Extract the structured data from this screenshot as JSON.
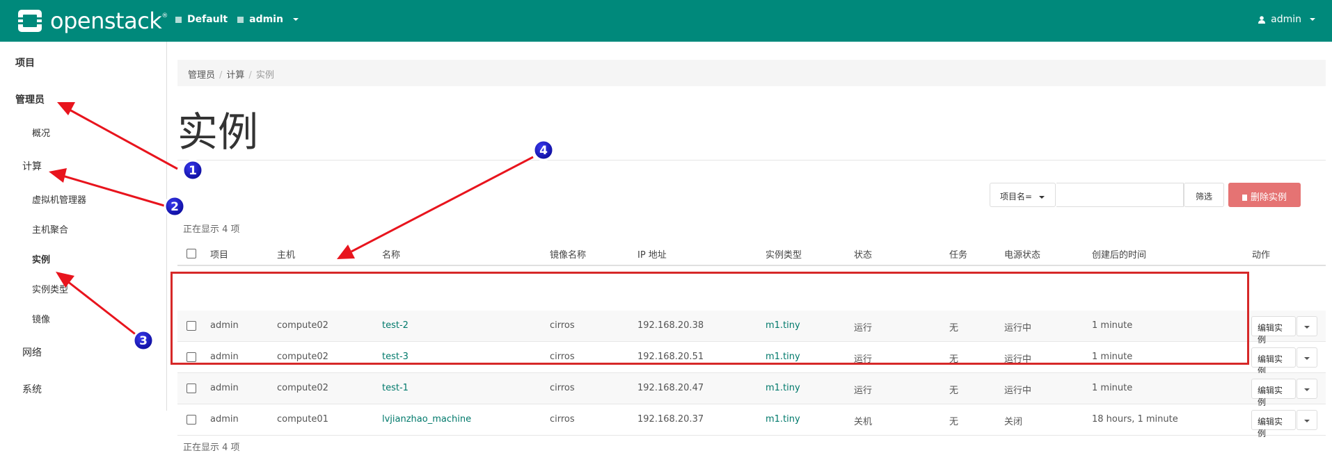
{
  "header": {
    "brand": "openstack",
    "domain": "Default",
    "project": "admin",
    "user": "admin"
  },
  "sidebar": {
    "items": [
      {
        "label": "项目"
      },
      {
        "label": "管理员"
      },
      {
        "label": "概况"
      },
      {
        "label": "计算"
      },
      {
        "label": "虚拟机管理器"
      },
      {
        "label": "主机聚合"
      },
      {
        "label": "实例"
      },
      {
        "label": "实例类型"
      },
      {
        "label": "镜像"
      },
      {
        "label": "网络"
      },
      {
        "label": "系统"
      }
    ]
  },
  "breadcrumb": [
    "管理员",
    "计算",
    "实例"
  ],
  "page_title": "实例",
  "filter": {
    "dropdown_label": "项目名=",
    "filter_button": "筛选",
    "delete_button": "删除实例"
  },
  "count_text": "正在显示 4 项",
  "table": {
    "columns": [
      "项目",
      "主机",
      "名称",
      "镜像名称",
      "IP 地址",
      "实例类型",
      "状态",
      "任务",
      "电源状态",
      "创建后的时间",
      "动作"
    ],
    "rows": [
      {
        "project": "admin",
        "host": "compute02",
        "name": "test-2",
        "image": "cirros",
        "ip": "192.168.20.38",
        "flavor": "m1.tiny",
        "status": "运行",
        "task": "无",
        "power": "运行中",
        "age": "1 minute",
        "action": "编辑实例"
      },
      {
        "project": "admin",
        "host": "compute02",
        "name": "test-3",
        "image": "cirros",
        "ip": "192.168.20.51",
        "flavor": "m1.tiny",
        "status": "运行",
        "task": "无",
        "power": "运行中",
        "age": "1 minute",
        "action": "编辑实例"
      },
      {
        "project": "admin",
        "host": "compute02",
        "name": "test-1",
        "image": "cirros",
        "ip": "192.168.20.47",
        "flavor": "m1.tiny",
        "status": "运行",
        "task": "无",
        "power": "运行中",
        "age": "1 minute",
        "action": "编辑实例"
      },
      {
        "project": "admin",
        "host": "compute01",
        "name": "lvjianzhao_machine",
        "image": "cirros",
        "ip": "192.168.20.37",
        "flavor": "m1.tiny",
        "status": "关机",
        "task": "无",
        "power": "关闭",
        "age": "18 hours, 1 minute",
        "action": "编辑实例"
      }
    ]
  },
  "annotations": [
    "1",
    "2",
    "3",
    "4"
  ],
  "colors": {
    "topbar": "#00897b",
    "link": "#00796b",
    "delete": "#e57373",
    "annotation_arrow": "#e8141d",
    "annotation_badge": "#1616c8",
    "highlight_box": "#d62828"
  }
}
